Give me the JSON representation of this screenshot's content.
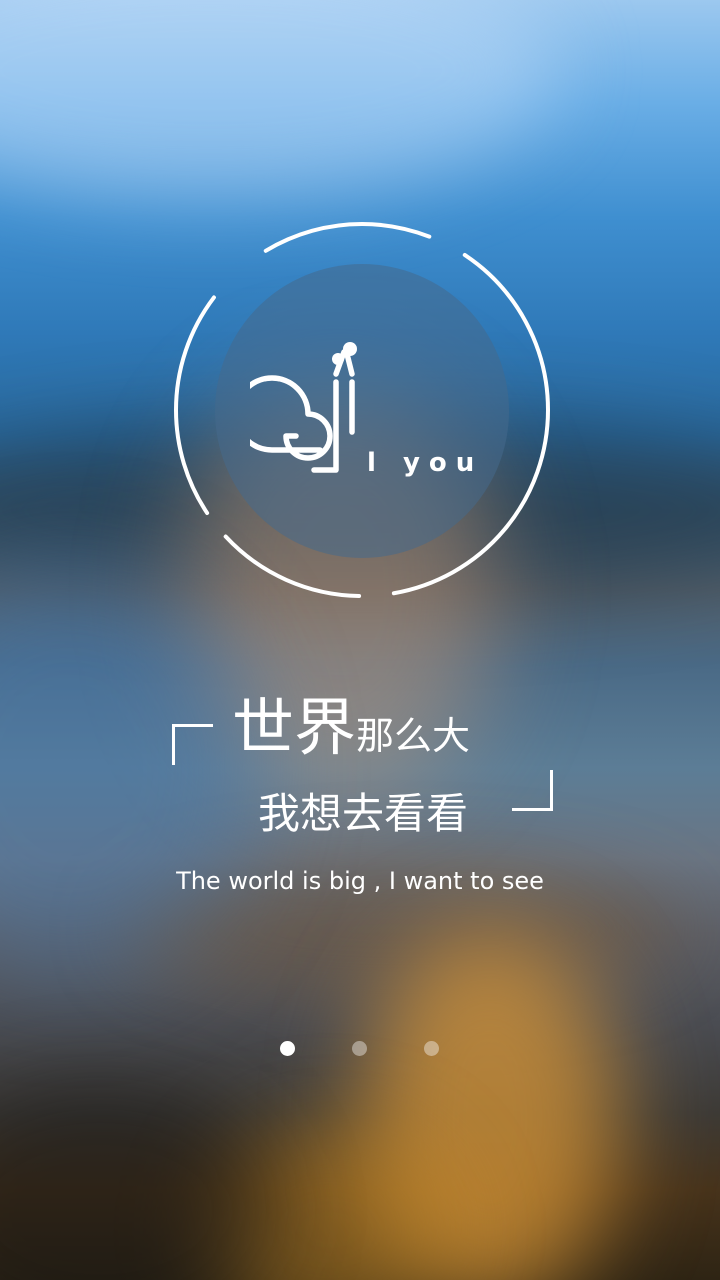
{
  "logo": {
    "wordmark": "l you",
    "icon_name": "snail-logo-icon"
  },
  "headline": {
    "large": "世界",
    "small": "那么大"
  },
  "subheadline": "我想去看看",
  "tagline": "The world is big , I want to see",
  "pager": {
    "total": 3,
    "active_index": 0
  },
  "colors": {
    "text": "#ffffff",
    "sky_top": "#9cc8ef",
    "sky_mid": "#3f8fd0",
    "city_lights": "#c98a3a"
  }
}
